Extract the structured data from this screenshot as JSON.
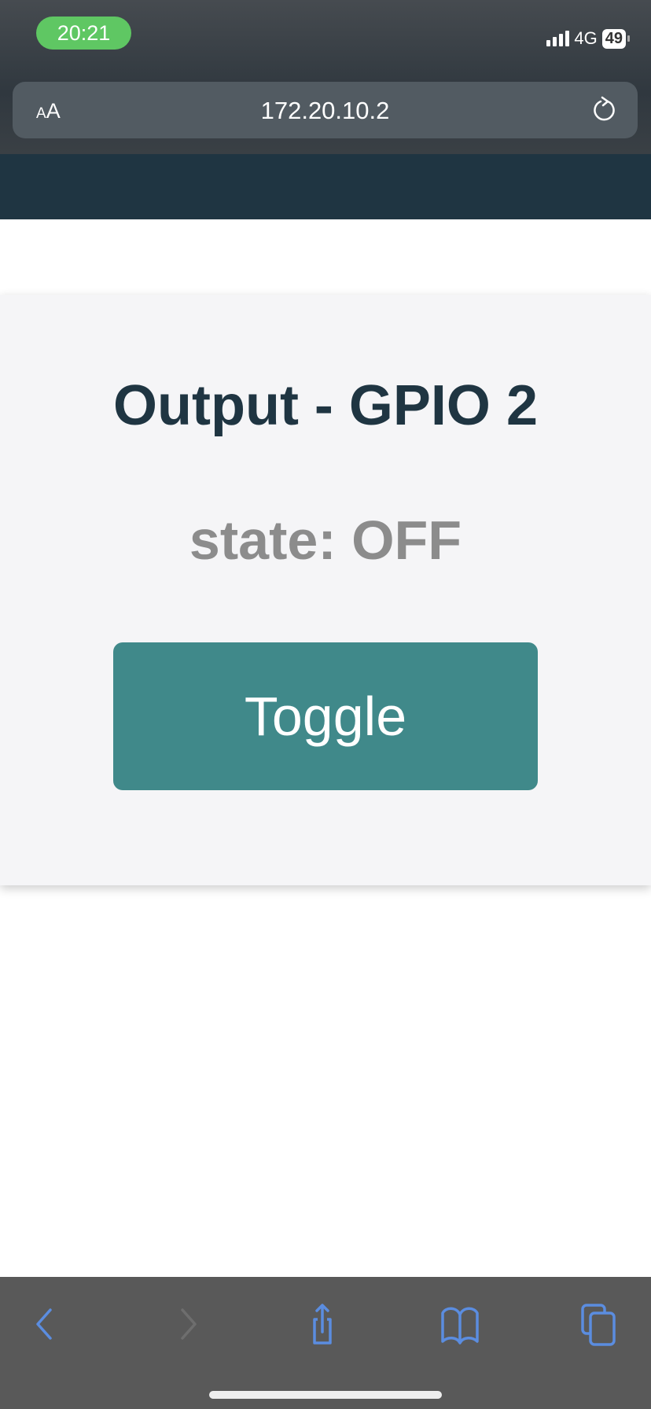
{
  "status_bar": {
    "time": "20:21",
    "network": "4G",
    "battery": "49"
  },
  "address_bar": {
    "text_size_label": "AA",
    "url": "172.20.10.2",
    "reload_icon": "reload-icon"
  },
  "card": {
    "title": "Output - GPIO 2",
    "state": "state: OFF",
    "toggle_label": "Toggle"
  },
  "colors": {
    "header": "#1f3542",
    "button": "#40898a",
    "state_text": "#8c8c8c",
    "toolbar_icons": "#5b8de0"
  },
  "toolbar": {
    "icons": [
      "back-icon",
      "forward-icon",
      "share-icon",
      "bookmarks-icon",
      "tabs-icon"
    ]
  }
}
